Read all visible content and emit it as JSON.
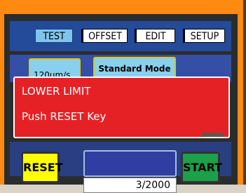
{
  "tabs": {
    "test": "TEST",
    "offset": "OFFSET",
    "edit": "EDIT",
    "setup": "SETUP"
  },
  "mode": {
    "speed": "120μm/s",
    "mode_label": "Standard Mode"
  },
  "message": {
    "line1": "LOWER LIMIT",
    "line2": "Push RESET Key"
  },
  "controls": {
    "reset": "RESET",
    "start": "START",
    "counter": "3/2000"
  },
  "colors": {
    "bezel": "#ff8a12",
    "panel_blue": "#2f4da5",
    "alarm_red": "#e62125",
    "reset_yellow": "#ffff00",
    "start_green": "#1da04a",
    "button_blue": "#88d0ee"
  }
}
